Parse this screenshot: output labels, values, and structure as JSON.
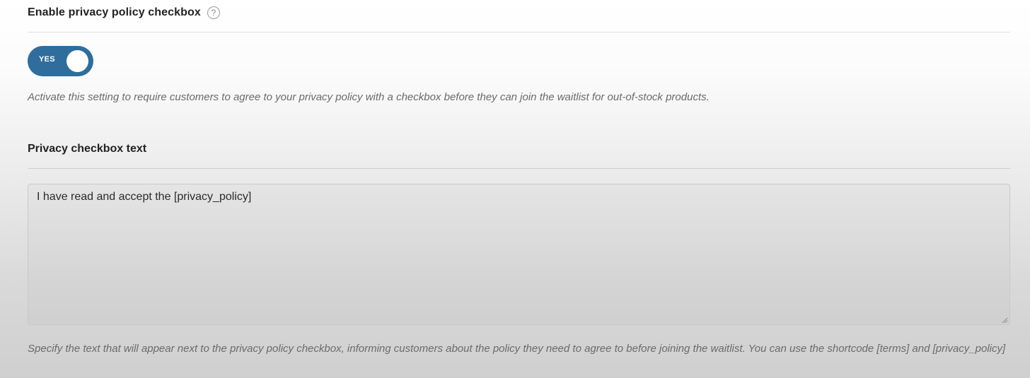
{
  "privacy_setting": {
    "title": "Enable privacy policy checkbox",
    "help_icon": "question-circle-icon",
    "toggle": {
      "label": "YES",
      "state": "on",
      "color": "#2e6d9c"
    },
    "description": "Activate this setting to require customers to agree to your privacy policy with a checkbox before they can join the waitlist for out-of-stock products."
  },
  "checkbox_text_setting": {
    "title": "Privacy checkbox text",
    "value": "I have read and accept the [privacy_policy]",
    "description": "Specify the text that will appear next to the privacy policy checkbox, informing customers about the policy they need to agree to before joining the waitlist. You can use the shortcode [terms] and [privacy_policy]"
  }
}
